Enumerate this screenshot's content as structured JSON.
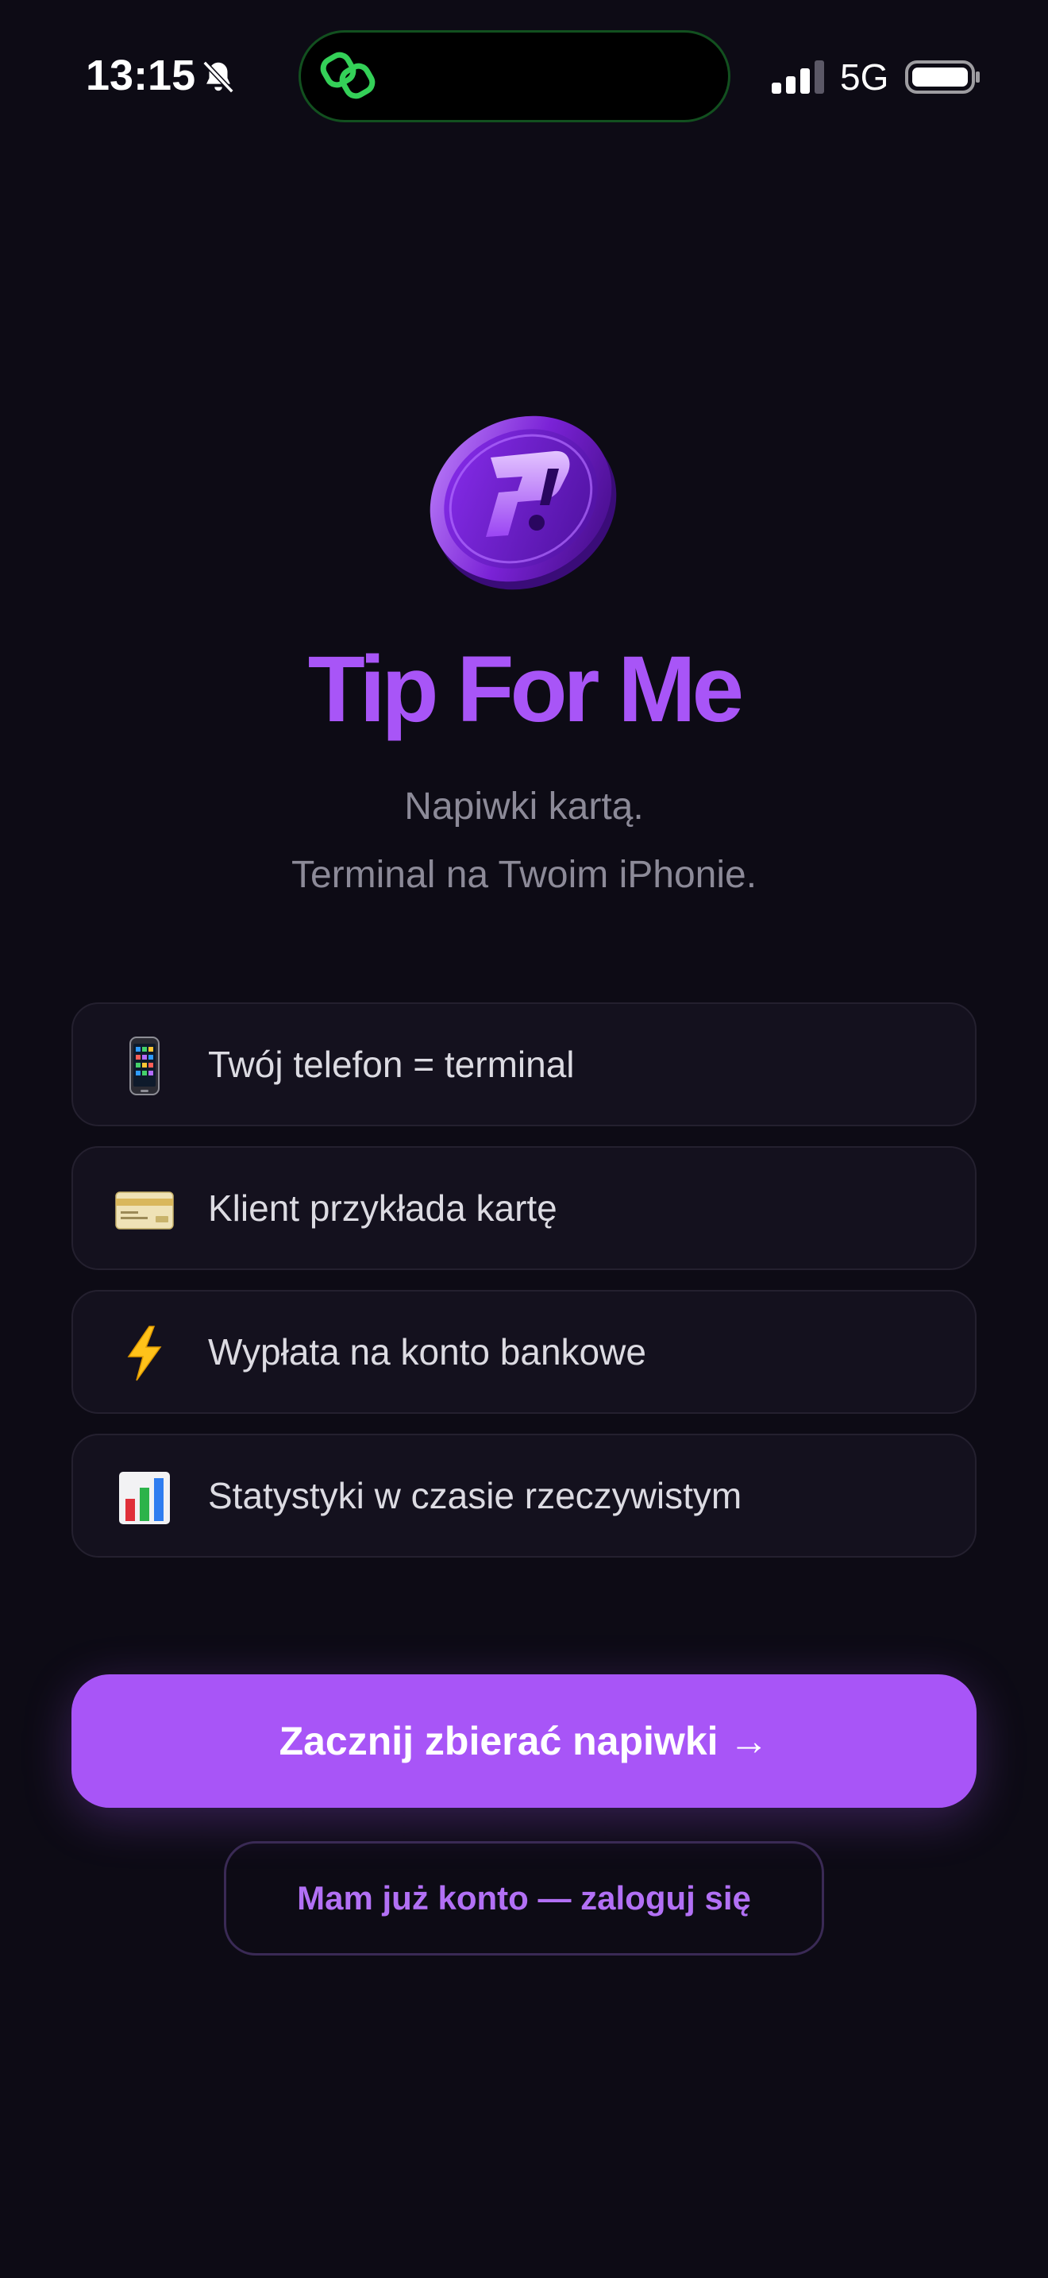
{
  "status_bar": {
    "time": "13:15",
    "network": "5G",
    "icons": [
      "bell-slash-icon",
      "link-icon",
      "signal-icon",
      "battery-icon"
    ]
  },
  "app": {
    "title": "Tip For Me",
    "tagline_line1": "Napiwki kartą.",
    "tagline_line2": "Terminal na Twoim iPhonie.",
    "accent_color": "#a855f7",
    "background_color": "#0d0b15"
  },
  "features": [
    {
      "icon": "mobile-phone-icon",
      "label": "Twój telefon = terminal"
    },
    {
      "icon": "credit-card-icon",
      "label": "Klient przykłada kartę"
    },
    {
      "icon": "lightning-icon",
      "label": "Wypłata na konto bankowe"
    },
    {
      "icon": "bar-chart-icon",
      "label": "Statystyki w czasie rzeczywistym"
    }
  ],
  "actions": {
    "primary_label": "Zacznij zbierać napiwki →",
    "secondary_label": "Mam już konto — zaloguj się"
  }
}
